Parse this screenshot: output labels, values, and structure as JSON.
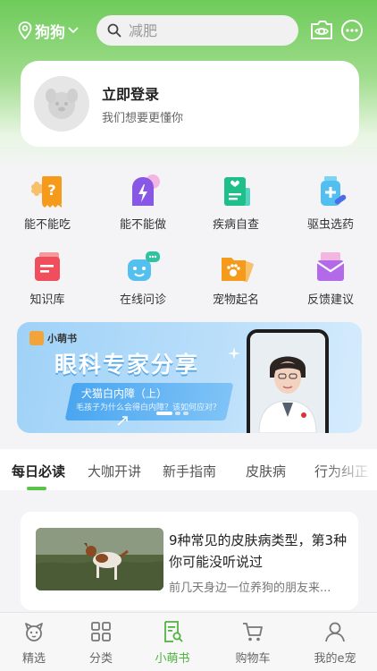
{
  "header": {
    "location": "狗狗",
    "search_placeholder": "减肥"
  },
  "login_card": {
    "title": "立即登录",
    "subtitle": "我们想要更懂你"
  },
  "quick_grid": [
    {
      "label": "能不能吃",
      "icon": "bone-tag-icon"
    },
    {
      "label": "能不能做",
      "icon": "lightning-bag-icon"
    },
    {
      "label": "疾病自查",
      "icon": "health-check-icon"
    },
    {
      "label": "驱虫选药",
      "icon": "medicine-bottle-icon"
    },
    {
      "label": "知识库",
      "icon": "knowledge-box-icon"
    },
    {
      "label": "在线问诊",
      "icon": "chat-consult-icon"
    },
    {
      "label": "宠物起名",
      "icon": "paw-folder-icon"
    },
    {
      "label": "反馈建议",
      "icon": "feedback-envelope-icon"
    }
  ],
  "banner": {
    "logo_text": "小萌书",
    "title": "眼科专家分享",
    "tag_title": "犬猫白内障（上）",
    "tag_subtitle": "毛孩子为什么会得白内障？该如何应对？"
  },
  "tabs": [
    {
      "label": "每日必读",
      "active": true
    },
    {
      "label": "大咖开讲",
      "active": false
    },
    {
      "label": "新手指南",
      "active": false
    },
    {
      "label": "皮肤病",
      "active": false
    },
    {
      "label": "行为纠正",
      "active": false
    }
  ],
  "article": {
    "title": "9种常见的皮肤病类型，第3种你可能没听说过",
    "snippet": "前几天身边一位养狗的朋友来..."
  },
  "bottom_nav": [
    {
      "label": "精选",
      "icon": "featured-dog-icon",
      "active": false
    },
    {
      "label": "分类",
      "icon": "grid-category-icon",
      "active": false
    },
    {
      "label": "小萌书",
      "icon": "book-search-icon",
      "active": true
    },
    {
      "label": "购物车",
      "icon": "cart-icon",
      "active": false
    },
    {
      "label": "我的e宠",
      "icon": "profile-icon",
      "active": false
    }
  ],
  "colors": {
    "brand_green": "#5bc24a",
    "banner_blue": "#4aa6f0"
  }
}
